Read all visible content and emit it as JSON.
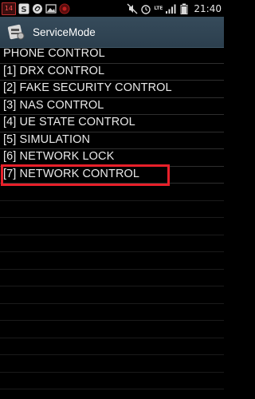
{
  "status_bar": {
    "notification_badge": "14",
    "time": "21:40",
    "network_type": "LTE",
    "icons": [
      "notification-badge-icon",
      "s-app-icon",
      "sync-icon",
      "image-icon",
      "record-icon",
      "mute-icon",
      "alarm-icon",
      "lte-icon",
      "signal-icon",
      "battery-icon"
    ]
  },
  "action_bar": {
    "title": "ServiceMode",
    "icon": "service-mode-app-icon"
  },
  "menu": {
    "header": "PHONE CONTROL",
    "items": [
      {
        "label": "[1] DRX CONTROL"
      },
      {
        "label": "[2] FAKE SECURITY CONTROL"
      },
      {
        "label": "[3] NAS CONTROL"
      },
      {
        "label": "[4] UE STATE CONTROL"
      },
      {
        "label": "[5] SIMULATION"
      },
      {
        "label": "[6] NETWORK LOCK"
      },
      {
        "label": "[7] NETWORK CONTROL"
      }
    ]
  },
  "annotation": {
    "highlight_color": "#e8202a",
    "highlighted_item": "[7] NETWORK CONTROL"
  },
  "colors": {
    "background": "#000000",
    "action_bar": "#2f4252",
    "text": "#e9e9e9"
  }
}
